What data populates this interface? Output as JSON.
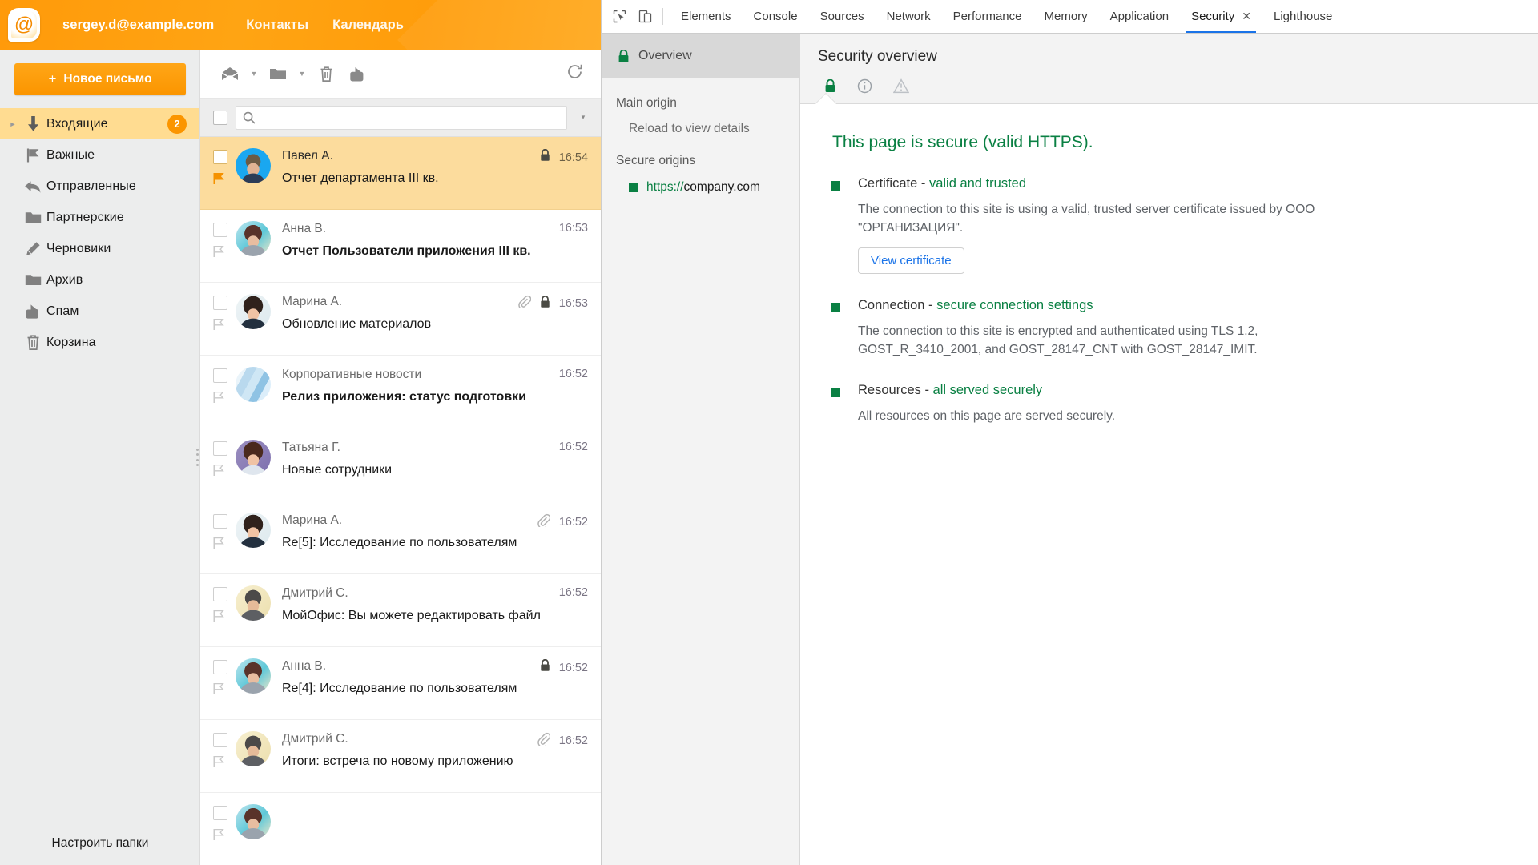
{
  "mail": {
    "topbar": {
      "logo_icon": "at-sign-logo-icon",
      "account": "sergey.d@example.com",
      "nav": [
        {
          "label": "Контакты"
        },
        {
          "label": "Календарь"
        }
      ]
    },
    "compose": {
      "plus": "+",
      "label": "Новое письмо"
    },
    "folders": [
      {
        "label": "Входящие",
        "icon": "inbox-arrow-down-icon",
        "badge": "2",
        "active": true,
        "twisty": "►"
      },
      {
        "label": "Важные",
        "icon": "flag-icon",
        "badge": "",
        "active": false,
        "twisty": ""
      },
      {
        "label": "Отправленные",
        "icon": "reply-arrow-icon",
        "badge": "",
        "active": false,
        "twisty": ""
      },
      {
        "label": "Партнерские",
        "icon": "folder-icon",
        "badge": "",
        "active": false,
        "twisty": ""
      },
      {
        "label": "Черновики",
        "icon": "pencil-icon",
        "badge": "",
        "active": false,
        "twisty": ""
      },
      {
        "label": "Архив",
        "icon": "folder-icon",
        "badge": "",
        "active": false,
        "twisty": ""
      },
      {
        "label": "Спам",
        "icon": "thumbs-down-icon",
        "badge": "",
        "active": false,
        "twisty": ""
      },
      {
        "label": "Корзина",
        "icon": "trash-icon",
        "badge": "",
        "active": false,
        "twisty": ""
      }
    ],
    "settings_link": "Настроить папки",
    "toolbar": {
      "mark_icon": "envelope-open-icon",
      "mark_caret": "▾",
      "move_icon": "folder-icon",
      "move_caret": "▾",
      "delete_icon": "trash-icon",
      "spam_icon": "thumbs-down-icon",
      "refresh_icon": "refresh-icon"
    },
    "search": {
      "value": "",
      "placeholder": "",
      "icon": "search-icon",
      "caret": "▾"
    },
    "messages": [
      {
        "sender": "Павел А.",
        "subject": "Отчет департамента III кв.",
        "time": "16:54",
        "unread": false,
        "selected": true,
        "flagged": true,
        "lock": true,
        "attach": false,
        "avatar": "photo-man-blue-bg"
      },
      {
        "sender": "Анна В.",
        "subject": "Отчет Пользователи приложения III кв.",
        "time": "16:53",
        "unread": true,
        "selected": false,
        "flagged": false,
        "lock": false,
        "attach": false,
        "avatar": "photo-woman-teal-bg"
      },
      {
        "sender": "Марина А.",
        "subject": "Обновление материалов",
        "time": "16:53",
        "unread": false,
        "selected": false,
        "flagged": false,
        "lock": true,
        "attach": true,
        "avatar": "photo-woman-white-bg"
      },
      {
        "sender": "Корпоративные новости",
        "subject": "Релиз приложения: статус подготовки",
        "time": "16:52",
        "unread": true,
        "selected": false,
        "flagged": false,
        "lock": false,
        "attach": false,
        "avatar": "photo-building"
      },
      {
        "sender": "Татьяна Г.",
        "subject": "Новые сотрудники",
        "time": "16:52",
        "unread": false,
        "selected": false,
        "flagged": false,
        "lock": false,
        "attach": false,
        "avatar": "photo-woman-purple-bg"
      },
      {
        "sender": "Марина А.",
        "subject": "Re[5]: Исследование по пользователям",
        "time": "16:52",
        "unread": false,
        "selected": false,
        "flagged": false,
        "lock": false,
        "attach": true,
        "avatar": "photo-woman-white-bg"
      },
      {
        "sender": "Дмитрий С.",
        "subject": "МойОфис: Вы можете редактировать файл",
        "time": "16:52",
        "unread": false,
        "selected": false,
        "flagged": false,
        "lock": false,
        "attach": false,
        "avatar": "photo-man-suit"
      },
      {
        "sender": "Анна В.",
        "subject": "Re[4]: Исследование по пользователям",
        "time": "16:52",
        "unread": false,
        "selected": false,
        "flagged": false,
        "lock": true,
        "attach": false,
        "avatar": "photo-woman-teal-bg"
      },
      {
        "sender": "Дмитрий С.",
        "subject": "Итоги: встреча по новому приложению",
        "time": "16:52",
        "unread": false,
        "selected": false,
        "flagged": false,
        "lock": false,
        "attach": true,
        "avatar": "photo-man-suit"
      },
      {
        "sender": "",
        "subject": "",
        "time": "",
        "unread": false,
        "selected": false,
        "flagged": false,
        "lock": false,
        "attach": false,
        "avatar": "photo-woman-teal-bg"
      }
    ]
  },
  "devtools": {
    "inspect_icon": "cursor-inspect-icon",
    "device_icon": "device-toolbar-icon",
    "tabs": [
      {
        "label": "Elements",
        "active": false,
        "closable": false
      },
      {
        "label": "Console",
        "active": false,
        "closable": false
      },
      {
        "label": "Sources",
        "active": false,
        "closable": false
      },
      {
        "label": "Network",
        "active": false,
        "closable": false
      },
      {
        "label": "Performance",
        "active": false,
        "closable": false
      },
      {
        "label": "Memory",
        "active": false,
        "closable": false
      },
      {
        "label": "Application",
        "active": false,
        "closable": false
      },
      {
        "label": "Security",
        "active": true,
        "closable": true,
        "close_glyph": "✕"
      },
      {
        "label": "Lighthouse",
        "active": false,
        "closable": false
      }
    ],
    "sidebar": {
      "overview_label": "Overview",
      "overview_icon": "green-lock-icon",
      "main_origin_title": "Main origin",
      "main_origin_item": "Reload to view details",
      "secure_origins_title": "Secure origins",
      "origins": [
        {
          "scheme": "https://",
          "host": "company.com"
        }
      ]
    },
    "main": {
      "title": "Security overview",
      "chips": [
        {
          "name": "lock-icon"
        },
        {
          "name": "info-circle-icon"
        },
        {
          "name": "warning-triangle-icon"
        }
      ],
      "summary": "This page is secure (valid HTTPS).",
      "sections": [
        {
          "title_prefix": "Certificate - ",
          "title_status": "valid and trusted",
          "description": "The connection to this site is using a valid, trusted server certificate issued by ООО \"ОРГАНИЗАЦИЯ\".",
          "button": "View certificate"
        },
        {
          "title_prefix": "Connection - ",
          "title_status": "secure connection settings",
          "description": "The connection to this site is encrypted and authenticated using TLS 1.2, GOST_R_3410_2001, and GOST_28147_CNT with GOST_28147_IMIT.",
          "button": ""
        },
        {
          "title_prefix": "Resources - ",
          "title_status": "all served securely",
          "description": "All resources on this page are served securely.",
          "button": ""
        }
      ]
    },
    "colors": {
      "accent": "#1a73e8",
      "secure_green": "#0a8043"
    }
  }
}
